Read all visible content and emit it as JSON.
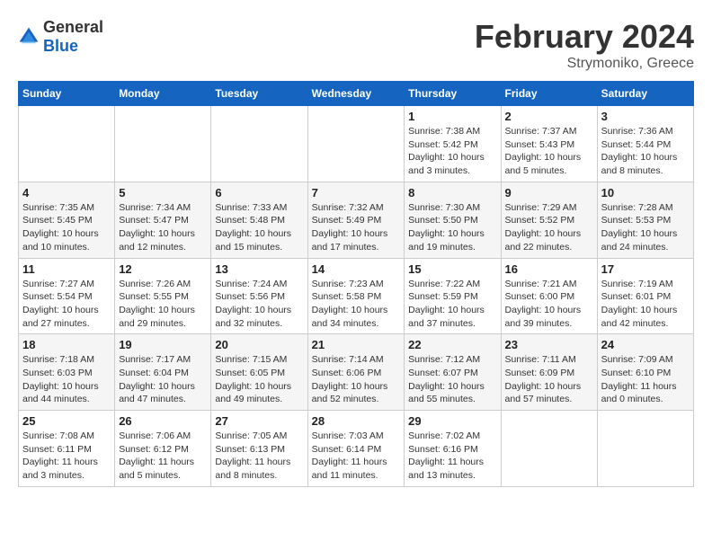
{
  "header": {
    "logo_general": "General",
    "logo_blue": "Blue",
    "month_title": "February 2024",
    "location": "Strymoniko, Greece"
  },
  "weekdays": [
    "Sunday",
    "Monday",
    "Tuesday",
    "Wednesday",
    "Thursday",
    "Friday",
    "Saturday"
  ],
  "weeks": [
    [
      {
        "day": "",
        "info": ""
      },
      {
        "day": "",
        "info": ""
      },
      {
        "day": "",
        "info": ""
      },
      {
        "day": "",
        "info": ""
      },
      {
        "day": "1",
        "info": "Sunrise: 7:38 AM\nSunset: 5:42 PM\nDaylight: 10 hours\nand 3 minutes."
      },
      {
        "day": "2",
        "info": "Sunrise: 7:37 AM\nSunset: 5:43 PM\nDaylight: 10 hours\nand 5 minutes."
      },
      {
        "day": "3",
        "info": "Sunrise: 7:36 AM\nSunset: 5:44 PM\nDaylight: 10 hours\nand 8 minutes."
      }
    ],
    [
      {
        "day": "4",
        "info": "Sunrise: 7:35 AM\nSunset: 5:45 PM\nDaylight: 10 hours\nand 10 minutes."
      },
      {
        "day": "5",
        "info": "Sunrise: 7:34 AM\nSunset: 5:47 PM\nDaylight: 10 hours\nand 12 minutes."
      },
      {
        "day": "6",
        "info": "Sunrise: 7:33 AM\nSunset: 5:48 PM\nDaylight: 10 hours\nand 15 minutes."
      },
      {
        "day": "7",
        "info": "Sunrise: 7:32 AM\nSunset: 5:49 PM\nDaylight: 10 hours\nand 17 minutes."
      },
      {
        "day": "8",
        "info": "Sunrise: 7:30 AM\nSunset: 5:50 PM\nDaylight: 10 hours\nand 19 minutes."
      },
      {
        "day": "9",
        "info": "Sunrise: 7:29 AM\nSunset: 5:52 PM\nDaylight: 10 hours\nand 22 minutes."
      },
      {
        "day": "10",
        "info": "Sunrise: 7:28 AM\nSunset: 5:53 PM\nDaylight: 10 hours\nand 24 minutes."
      }
    ],
    [
      {
        "day": "11",
        "info": "Sunrise: 7:27 AM\nSunset: 5:54 PM\nDaylight: 10 hours\nand 27 minutes."
      },
      {
        "day": "12",
        "info": "Sunrise: 7:26 AM\nSunset: 5:55 PM\nDaylight: 10 hours\nand 29 minutes."
      },
      {
        "day": "13",
        "info": "Sunrise: 7:24 AM\nSunset: 5:56 PM\nDaylight: 10 hours\nand 32 minutes."
      },
      {
        "day": "14",
        "info": "Sunrise: 7:23 AM\nSunset: 5:58 PM\nDaylight: 10 hours\nand 34 minutes."
      },
      {
        "day": "15",
        "info": "Sunrise: 7:22 AM\nSunset: 5:59 PM\nDaylight: 10 hours\nand 37 minutes."
      },
      {
        "day": "16",
        "info": "Sunrise: 7:21 AM\nSunset: 6:00 PM\nDaylight: 10 hours\nand 39 minutes."
      },
      {
        "day": "17",
        "info": "Sunrise: 7:19 AM\nSunset: 6:01 PM\nDaylight: 10 hours\nand 42 minutes."
      }
    ],
    [
      {
        "day": "18",
        "info": "Sunrise: 7:18 AM\nSunset: 6:03 PM\nDaylight: 10 hours\nand 44 minutes."
      },
      {
        "day": "19",
        "info": "Sunrise: 7:17 AM\nSunset: 6:04 PM\nDaylight: 10 hours\nand 47 minutes."
      },
      {
        "day": "20",
        "info": "Sunrise: 7:15 AM\nSunset: 6:05 PM\nDaylight: 10 hours\nand 49 minutes."
      },
      {
        "day": "21",
        "info": "Sunrise: 7:14 AM\nSunset: 6:06 PM\nDaylight: 10 hours\nand 52 minutes."
      },
      {
        "day": "22",
        "info": "Sunrise: 7:12 AM\nSunset: 6:07 PM\nDaylight: 10 hours\nand 55 minutes."
      },
      {
        "day": "23",
        "info": "Sunrise: 7:11 AM\nSunset: 6:09 PM\nDaylight: 10 hours\nand 57 minutes."
      },
      {
        "day": "24",
        "info": "Sunrise: 7:09 AM\nSunset: 6:10 PM\nDaylight: 11 hours\nand 0 minutes."
      }
    ],
    [
      {
        "day": "25",
        "info": "Sunrise: 7:08 AM\nSunset: 6:11 PM\nDaylight: 11 hours\nand 3 minutes."
      },
      {
        "day": "26",
        "info": "Sunrise: 7:06 AM\nSunset: 6:12 PM\nDaylight: 11 hours\nand 5 minutes."
      },
      {
        "day": "27",
        "info": "Sunrise: 7:05 AM\nSunset: 6:13 PM\nDaylight: 11 hours\nand 8 minutes."
      },
      {
        "day": "28",
        "info": "Sunrise: 7:03 AM\nSunset: 6:14 PM\nDaylight: 11 hours\nand 11 minutes."
      },
      {
        "day": "29",
        "info": "Sunrise: 7:02 AM\nSunset: 6:16 PM\nDaylight: 11 hours\nand 13 minutes."
      },
      {
        "day": "",
        "info": ""
      },
      {
        "day": "",
        "info": ""
      }
    ]
  ]
}
